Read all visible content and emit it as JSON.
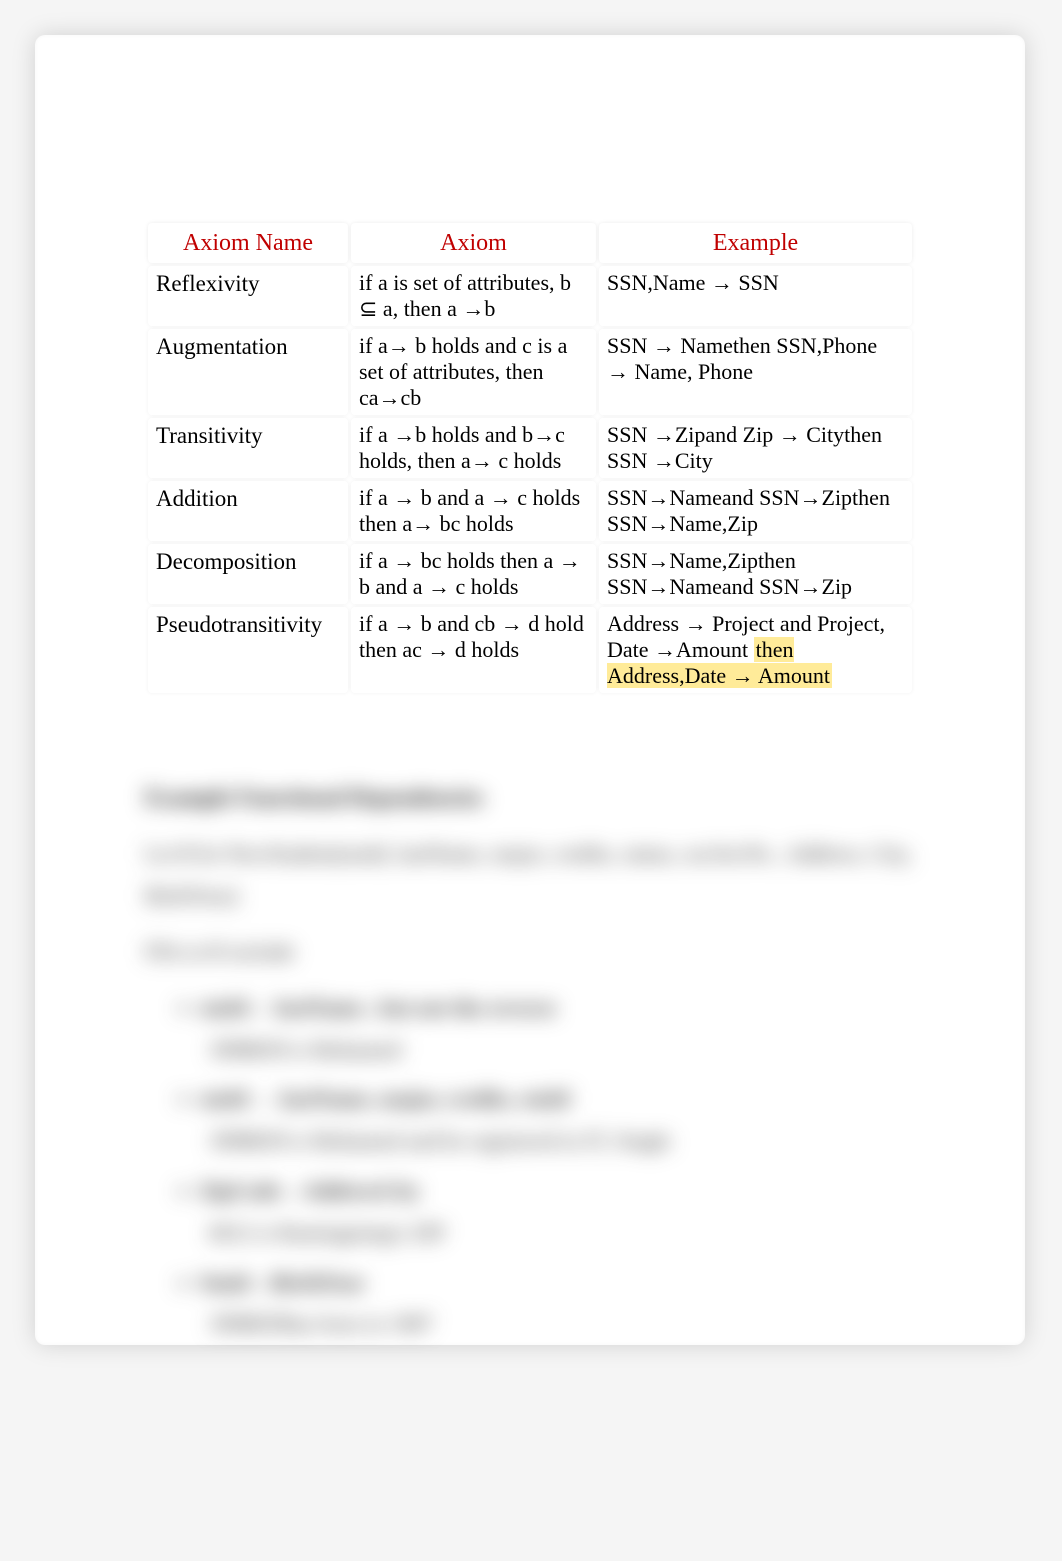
{
  "table": {
    "headers": {
      "name": "Axiom Name",
      "axiom": "Axiom",
      "example": "Example"
    },
    "rows": [
      {
        "name": "Reflexivity",
        "axiom": "if a is set of attributes, b ⊆ a, then a →b",
        "example": "SSN,Name → SSN"
      },
      {
        "name": "Augmentation",
        "axiom": "if a→ b holds and c is a set of attributes, then ca→cb",
        "example": "SSN → Namethen SSN,Phone → Name, Phone"
      },
      {
        "name": "Transitivity",
        "axiom": "if a →b holds and b→c holds, then a→ c holds",
        "example": "SSN →Zipand Zip → Citythen SSN →City"
      },
      {
        "name": "Addition",
        "axiom": "if a → b and a → c holds then a→ bc holds",
        "example": "SSN→Nameand SSN→Zipthen SSN→Name,Zip"
      },
      {
        "name": "Decomposition",
        "axiom": "if a → bc holds then a → b and a → c holds",
        "example": "SSN→Name,Zipthen SSN→Nameand SSN→Zip"
      },
      {
        "name": "Pseudotransitivity",
        "axiom": "if a → b and cb → d hold then ac → d holds",
        "example_plain": "Address → Project and Project, Date →Amount ",
        "example_hl": "then Address,Date → Amount"
      }
    ]
  },
  "section": {
    "heading": "Example Functional Dependencies",
    "lead": "Let R be NewStudent(stuId, lastName, major, credits, status, socSecNo , Address, City, BirthYear)",
    "intro": "FDs in R include",
    "items": [
      {
        "main": "stuId→ lastName , but not the reverse",
        "sub": "3998839 is Mohamed"
      },
      {
        "main": "stuId → lastName, major, credits, stuId",
        "sub": "3998839 is Mohamed and he registered in IT, Single"
      },
      {
        "main": "ZipCode→AddressCity",
        "sub": "6012 is Ramingining's ZIP"
      },
      {
        "main": "Stuid→BirthYear",
        "sub": "3998839has born in 1987"
      }
    ]
  }
}
